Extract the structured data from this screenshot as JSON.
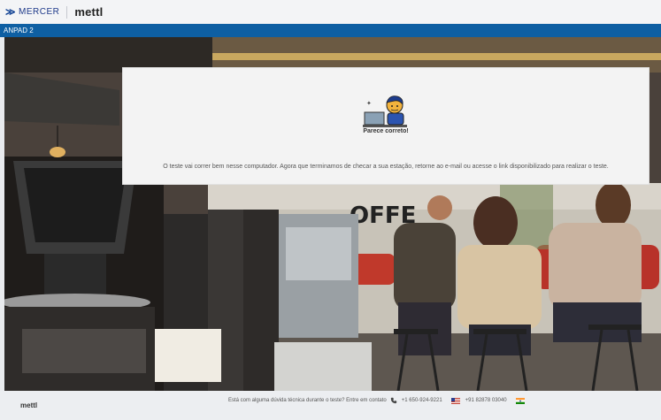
{
  "header": {
    "mercer_logo_text": "MERCER",
    "mettl_logo_text": "mettl"
  },
  "subbar": {
    "label": "ANPAD 2"
  },
  "card": {
    "title": "Parece correto!",
    "message": "O teste vai correr bem nesse computador. Agora que terminamos de checar a sua estação, retorne ao e-mail ou acesse o link disponibilizado para realizar o teste."
  },
  "footer": {
    "logo_text": "mettl",
    "support_text": "Está com alguma dúvida técnica durante o teste? Entre em contato",
    "phone_us": "+1 650-924-9221",
    "phone_in": "+91 82878 03040",
    "icons": [
      "phone-icon",
      "us-flag-icon",
      "india-flag-icon"
    ]
  },
  "background": {
    "sign_text": "OFFE"
  },
  "colors": {
    "brand_blue": "#0e5fa3",
    "mettl_teal": "#13a89e",
    "card_bg": "#f3f3f3"
  }
}
